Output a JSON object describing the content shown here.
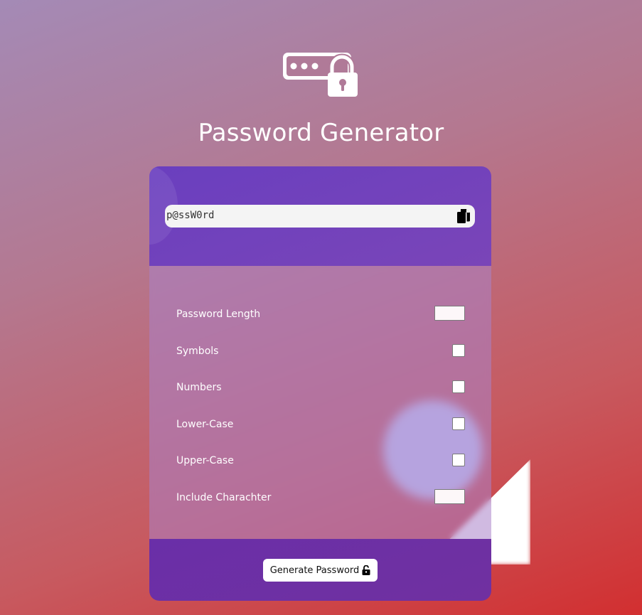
{
  "header": {
    "logo_icon": "password-lock-icon",
    "title": "Password Generator"
  },
  "output": {
    "password": "p@ssW0rd",
    "copy_icon": "copy-icon"
  },
  "options": {
    "length_label": "Password Length",
    "symbols_label": "Symbols",
    "numbers_label": "Numbers",
    "lowercase_label": "Lower-Case",
    "uppercase_label": "Upper-Case",
    "include_label": "Include Charachter",
    "length_value": "",
    "include_value": ""
  },
  "actions": {
    "generate_label": "Generate Password",
    "generate_icon": "unlock-icon"
  },
  "colors": {
    "card_top": "#6a3fbf",
    "card_bottom": "#6a2fa8",
    "accent_blob": "#c6cdfa"
  }
}
